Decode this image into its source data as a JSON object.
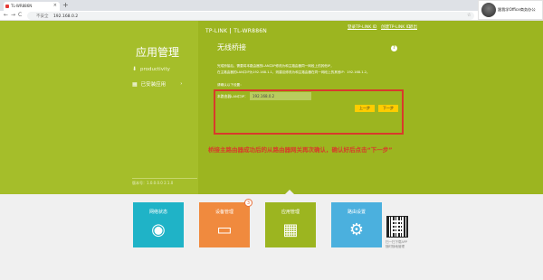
{
  "browser": {
    "tab_title": "TL-WR886N",
    "tab_close": "×",
    "new_tab": "+",
    "back": "←",
    "forward": "→",
    "reload": "C",
    "security": "不安全",
    "url": "192.168.0.2",
    "star": "☆",
    "menu": "⋮"
  },
  "overlay": {
    "name": "跟我学Office商务办公"
  },
  "header": {
    "brand": "TP-LINK",
    "model": "TL-WR886N",
    "link1": "登录TP-LINK ID",
    "link2": "创建TP-LINK ID",
    "link3": "退出"
  },
  "sidebar": {
    "title": "应用管理",
    "items": [
      {
        "icon": "download-icon",
        "label": "productivity"
      },
      {
        "icon": "grid-icon",
        "label": "已安装应用",
        "arrow": "›"
      }
    ],
    "footer": "版本号：1.0.0.0.0 2.1.0"
  },
  "page": {
    "title": "无线桥接",
    "help": "?",
    "desc1": "完成桥接后，需要将本路由器的LAN口IP修改为和主路由器同一网段上的其他IP，",
    "desc2": "在主路由器的LAN口IP为192.168.1.1，则建议修改为和主路由器在同一网段上的其他IP：192.168.1.2。",
    "step": "请确认以下设置：",
    "field_label": "本路由器LAN口IP：",
    "field_value": "192.168.0.2",
    "prev_button": "上一步",
    "next_button": "下一步"
  },
  "annotation": "桥接主路由器成功后的从路由器网关再次确认，确认好后点击“下一步”",
  "tiles": [
    {
      "label": "网络状态",
      "color": "#1fb3c7",
      "icon": "globe-icon",
      "glyph": "◉"
    },
    {
      "label": "设备管理",
      "color": "#f08a3e",
      "icon": "laptop-icon",
      "glyph": "▭",
      "badge": "3"
    },
    {
      "label": "应用管理",
      "color": "#9cb520",
      "icon": "apps-icon",
      "glyph": "▦"
    },
    {
      "label": "路由设置",
      "color": "#4bb0de",
      "icon": "gear-icon",
      "glyph": "⚙"
    }
  ],
  "qr": {
    "line1": "扫一扫下载APP",
    "line2": "随时随地管理"
  }
}
